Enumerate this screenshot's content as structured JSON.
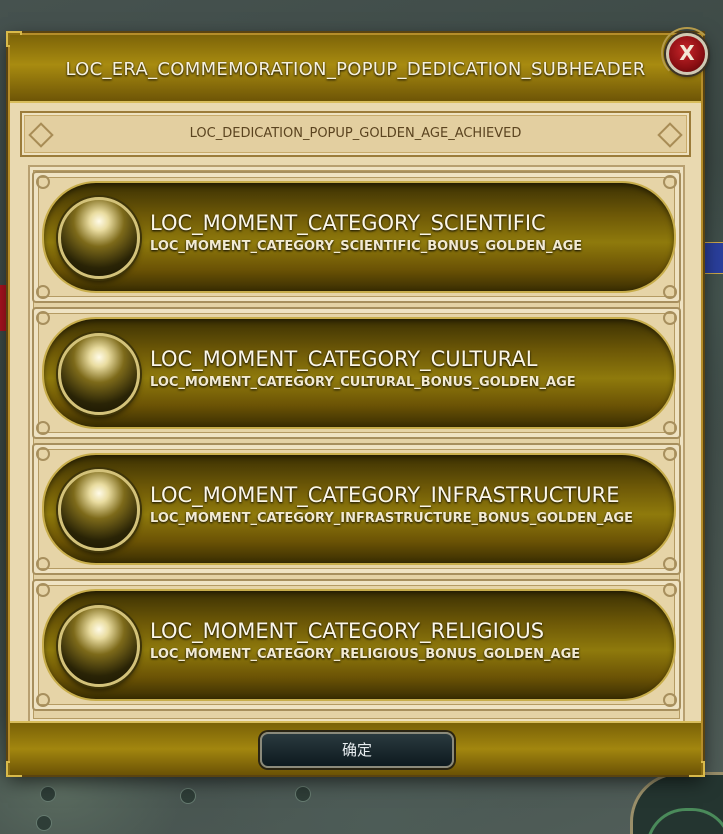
{
  "popup": {
    "header_title": "LOC_ERA_COMMEMORATION_POPUP_DEDICATION_SUBHEADER",
    "subheader": "LOC_DEDICATION_POPUP_GOLDEN_AGE_ACHIEVED",
    "close_label": "X",
    "confirm_label": "确定"
  },
  "dedications": [
    {
      "title": "LOC_MOMENT_CATEGORY_SCIENTIFIC",
      "subtitle": "LOC_MOMENT_CATEGORY_SCIENTIFIC_BONUS_GOLDEN_AGE"
    },
    {
      "title": "LOC_MOMENT_CATEGORY_CULTURAL",
      "subtitle": "LOC_MOMENT_CATEGORY_CULTURAL_BONUS_GOLDEN_AGE"
    },
    {
      "title": "LOC_MOMENT_CATEGORY_INFRASTRUCTURE",
      "subtitle": "LOC_MOMENT_CATEGORY_INFRASTRUCTURE_BONUS_GOLDEN_AGE"
    },
    {
      "title": "LOC_MOMENT_CATEGORY_RELIGIOUS",
      "subtitle": "LOC_MOMENT_CATEGORY_RELIGIOUS_BONUS_GOLDEN_AGE"
    }
  ]
}
